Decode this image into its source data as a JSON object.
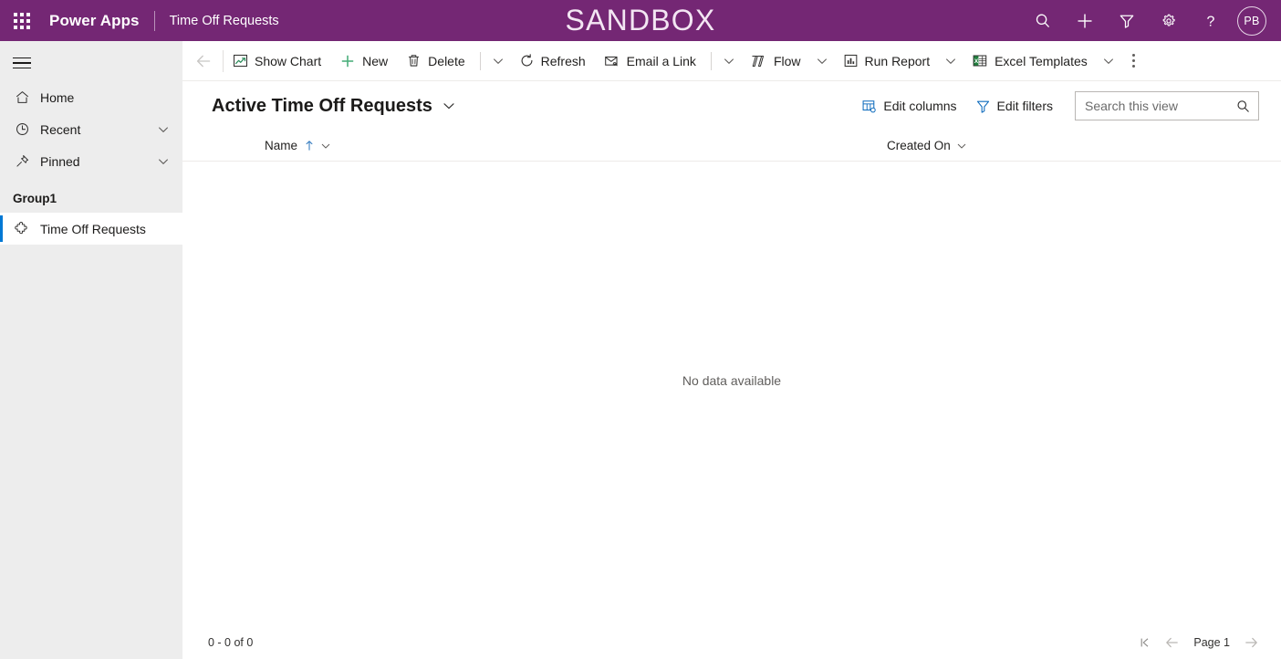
{
  "header": {
    "waffle_label": "app-launcher",
    "brand": "Power Apps",
    "app_name": "Time Off Requests",
    "environment_banner": "SANDBOX",
    "icons": [
      {
        "name": "search-icon",
        "label": "Search"
      },
      {
        "name": "plus-icon",
        "label": "New"
      },
      {
        "name": "filter-icon",
        "label": "Filter"
      },
      {
        "name": "gear-icon",
        "label": "Settings"
      },
      {
        "name": "help-icon",
        "label": "Help"
      }
    ],
    "avatar_initials": "PB",
    "brand_color": "#742774",
    "sandbox_text_color": "#f3e6f3"
  },
  "sidebar": {
    "hamburger_label": "Site map",
    "items": [
      {
        "label": "Home",
        "icon": "home-icon",
        "has_chevron": false,
        "selected": false
      },
      {
        "label": "Recent",
        "icon": "clock-icon",
        "has_chevron": true,
        "selected": false
      },
      {
        "label": "Pinned",
        "icon": "pin-icon",
        "has_chevron": true,
        "selected": false
      }
    ],
    "group_label": "Group1",
    "group_items": [
      {
        "label": "Time Off Requests",
        "icon": "puzzle-icon",
        "selected": true
      }
    ],
    "accent_color": "#0078d4",
    "background_color": "#ededed"
  },
  "commandbar": {
    "back_label": "Back",
    "commands": [
      {
        "label": "Show Chart",
        "icon": "chart-icon",
        "caret": false
      },
      {
        "label": "New",
        "icon": "plus-icon",
        "caret": false
      },
      {
        "label": "Delete",
        "icon": "trash-icon",
        "caret": false,
        "separator_after": true,
        "caret_after": true
      },
      {
        "label": "Refresh",
        "icon": "refresh-icon",
        "caret": false
      },
      {
        "label": "Email a Link",
        "icon": "email-link-icon",
        "caret": false,
        "separator_after": true,
        "caret_after": true
      },
      {
        "label": "Flow",
        "icon": "flow-icon",
        "caret_after": true
      },
      {
        "label": "Run Report",
        "icon": "report-icon",
        "caret_after": true
      },
      {
        "label": "Excel Templates",
        "icon": "excel-icon",
        "caret_after": true
      }
    ],
    "overflow_label": "More commands"
  },
  "view": {
    "title": "Active Time Off Requests",
    "title_caret_label": "Change view",
    "edit_columns_label": "Edit columns",
    "edit_filters_label": "Edit filters",
    "search_placeholder": "Search this view",
    "search_value": ""
  },
  "grid": {
    "columns": [
      {
        "label": "Name",
        "sorted": true,
        "sort_direction": "asc"
      },
      {
        "label": "Created On",
        "sorted": false
      }
    ],
    "rows": [],
    "empty_message": "No data available"
  },
  "footer": {
    "record_count": "0 - 0 of 0",
    "page_label": "Page 1",
    "first_page_label": "First page",
    "previous_page_label": "Previous page",
    "next_page_label": "Next page"
  }
}
